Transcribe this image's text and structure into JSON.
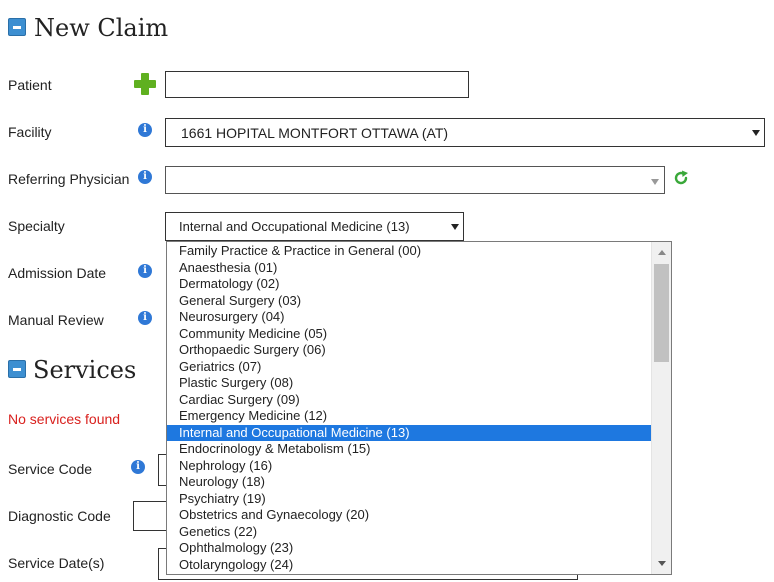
{
  "new_claim": {
    "title": "New Claim"
  },
  "form": {
    "patient_label": "Patient",
    "patient_value": "",
    "facility_label": "Facility",
    "facility_value": "1661 HOPITAL MONTFORT OTTAWA (AT)",
    "referring_label": "Referring Physician",
    "referring_value": "",
    "specialty_label": "Specialty",
    "specialty_value": "Internal and Occupational Medicine (13)",
    "admission_label": "Admission Date",
    "manual_review_label": "Manual Review"
  },
  "services": {
    "title": "Services",
    "empty_message": "No services found",
    "service_code_label": "Service Code",
    "diagnostic_code_label": "Diagnostic Code",
    "service_dates_label": "Service Date(s)"
  },
  "specialty_dropdown": {
    "selected_index": 11,
    "options": [
      "Family Practice & Practice in General (00)",
      "Anaesthesia (01)",
      "Dermatology (02)",
      "General Surgery (03)",
      "Neurosurgery (04)",
      "Community Medicine (05)",
      "Orthopaedic Surgery (06)",
      "Geriatrics (07)",
      "Plastic Surgery (08)",
      "Cardiac Surgery (09)",
      "Emergency Medicine (12)",
      "Internal and Occupational Medicine (13)",
      "Endocrinology & Metabolism (15)",
      "Nephrology (16)",
      "Neurology (18)",
      "Psychiatry (19)",
      "Obstetrics and Gynaecology (20)",
      "Genetics (22)",
      "Ophthalmology (23)",
      "Otolaryngology (24)"
    ]
  },
  "icons": {
    "info": "i",
    "collapse": "minus-icon",
    "add": "plus-icon",
    "refresh": "refresh-icon"
  },
  "colors": {
    "accent": "#3d8fd1",
    "error": "#d9211e",
    "selected": "#1e78e0",
    "add_green": "#5fb020"
  }
}
